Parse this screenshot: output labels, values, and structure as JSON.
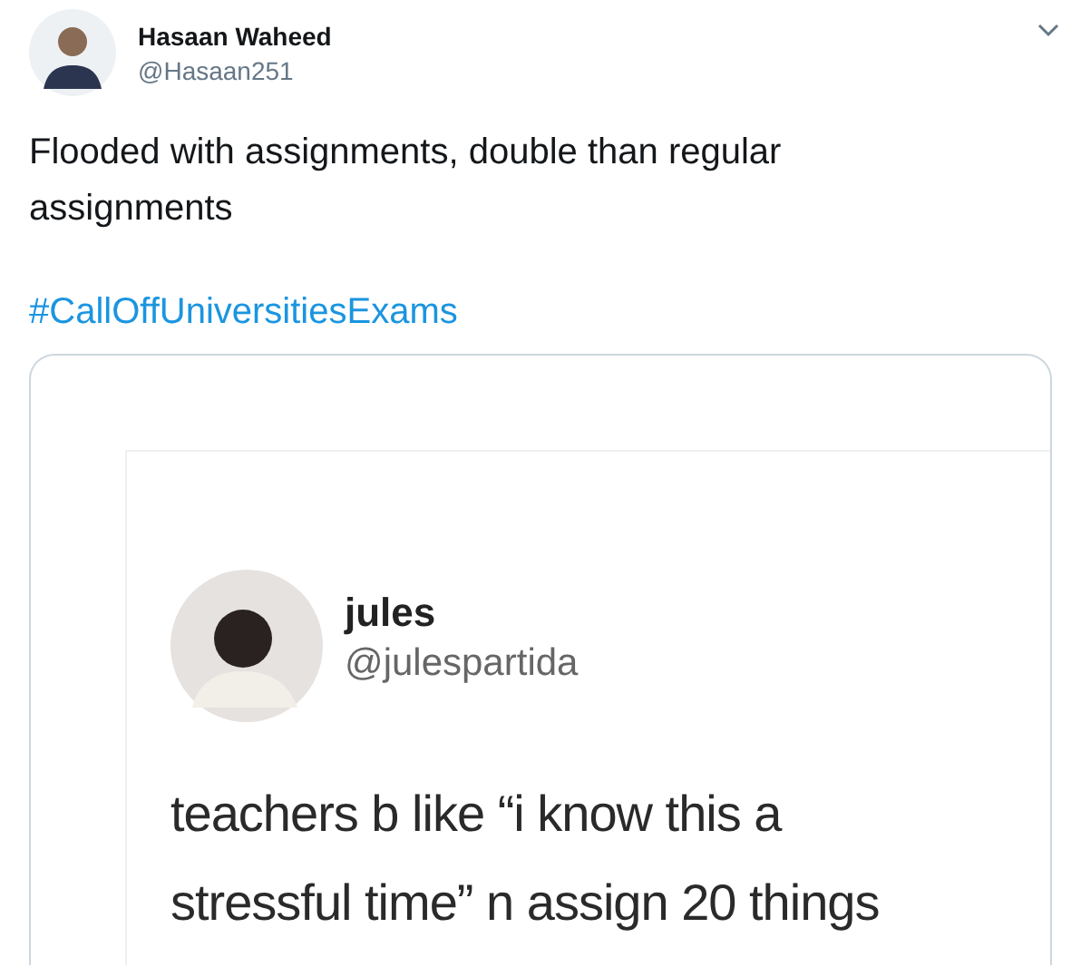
{
  "tweet": {
    "author_name": "Hasaan Waheed",
    "handle": "@Hasaan251",
    "text": "Flooded with assignments, double than regular assignments",
    "hashtag": "#CallOffUniversitiesExams"
  },
  "embedded_screenshot": {
    "author_name": "jules",
    "handle": "@julespartida",
    "text": "teachers b like “i know this a stressful time” n assign 20 things"
  }
}
